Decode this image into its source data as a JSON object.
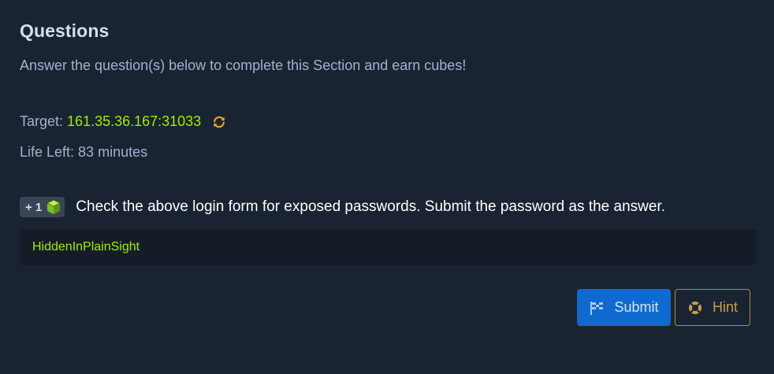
{
  "section": {
    "title": "Questions",
    "subtitle": "Answer the question(s) below to complete this Section and earn cubes!"
  },
  "target": {
    "label": "Target:",
    "value": "161.35.36.167:31033",
    "refresh_icon": "refresh-icon"
  },
  "life": {
    "text": "Life Left: 83 minutes"
  },
  "question": {
    "badge_label": "+ 1",
    "badge_icon": "cube-icon",
    "text": "Check the above login form for exposed passwords. Submit the password as the answer.",
    "answer_value": "HiddenInPlainSight"
  },
  "actions": {
    "submit_label": "Submit",
    "submit_icon": "flag-icon",
    "hint_label": "Hint",
    "hint_icon": "lifebuoy-icon"
  },
  "colors": {
    "background": "#1a2332",
    "accent_green": "#9fef00",
    "submit_blue": "#0f6acf",
    "hint_gold": "#c5a043"
  }
}
